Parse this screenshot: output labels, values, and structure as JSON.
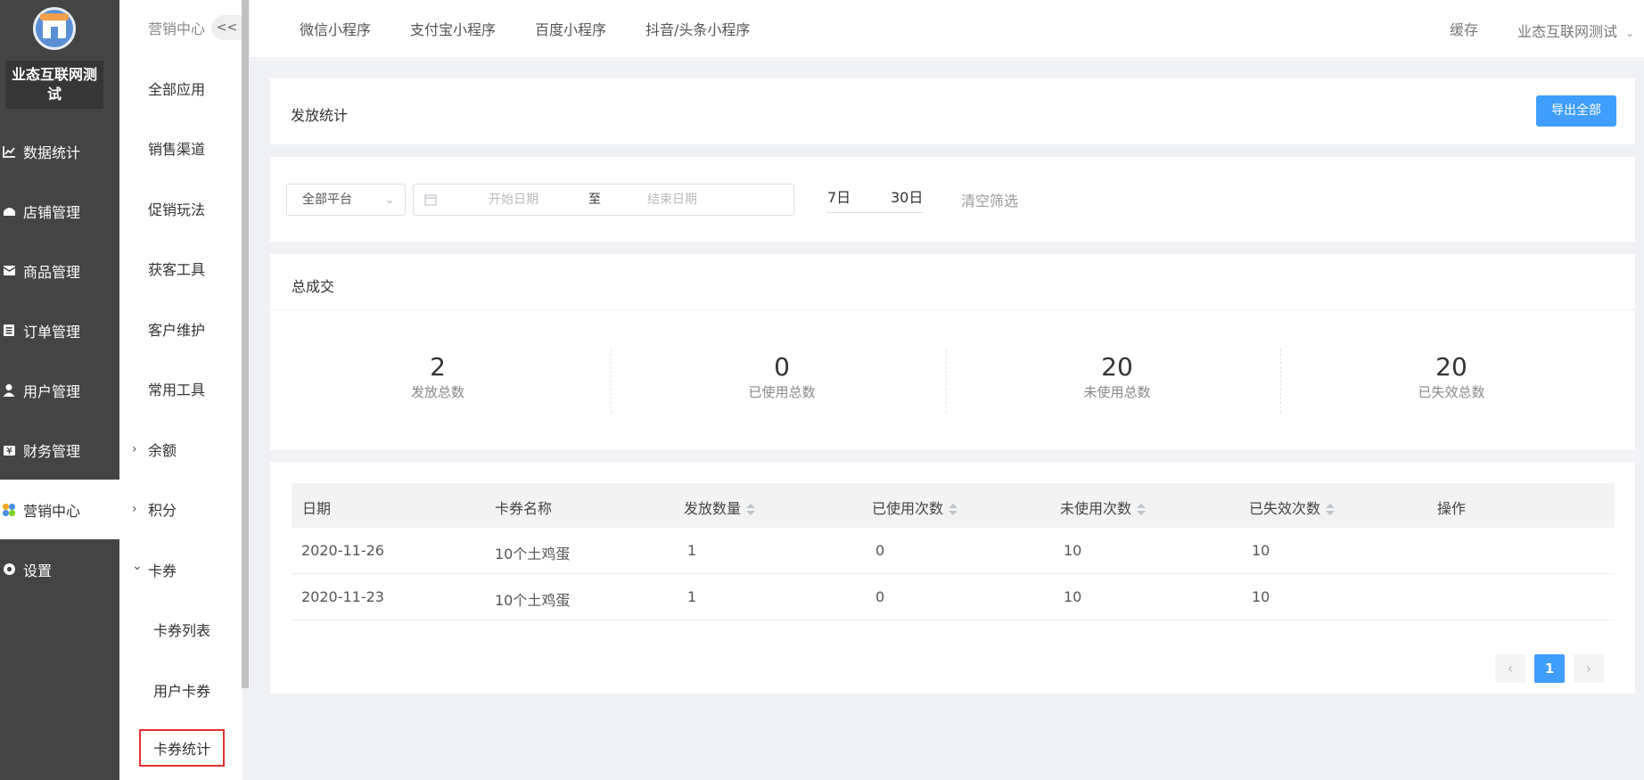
{
  "app": {
    "shop_name": "业态互联网测试"
  },
  "sidebar": {
    "items": [
      {
        "label": "数据统计",
        "icon": "chart-line-icon"
      },
      {
        "label": "店铺管理",
        "icon": "store-icon"
      },
      {
        "label": "商品管理",
        "icon": "product-icon"
      },
      {
        "label": "订单管理",
        "icon": "order-icon"
      },
      {
        "label": "用户管理",
        "icon": "user-icon"
      },
      {
        "label": "财务管理",
        "icon": "finance-icon"
      },
      {
        "label": "营销中心",
        "icon": "marketing-icon",
        "active": true
      },
      {
        "label": "设置",
        "icon": "settings-icon"
      }
    ]
  },
  "subnav": {
    "title": "营销中心",
    "collapse_label": "<<",
    "items": [
      {
        "label": "全部应用"
      },
      {
        "label": "销售渠道"
      },
      {
        "label": "促销玩法"
      },
      {
        "label": "获客工具"
      },
      {
        "label": "客户维护"
      },
      {
        "label": "常用工具"
      },
      {
        "label": "余额",
        "chevron": "›"
      },
      {
        "label": "积分",
        "chevron": "›"
      },
      {
        "label": "卡券",
        "chevron": "⌄"
      },
      {
        "label": "卡券列表"
      },
      {
        "label": "用户卡券"
      },
      {
        "label": "卡券统计",
        "selected": true
      }
    ]
  },
  "topbar": {
    "tabs": [
      "微信小程序",
      "支付宝小程序",
      "百度小程序",
      "抖音/头条小程序"
    ],
    "cache_label": "缓存",
    "account_label": "业态互联网测试"
  },
  "header_card": {
    "title": "发放统计",
    "export_label": "导出全部"
  },
  "filter": {
    "platform_value": "全部平台",
    "start_placeholder": "开始日期",
    "to_label": "至",
    "end_placeholder": "结束日期",
    "quick_7": "7日",
    "quick_30": "30日",
    "clear_label": "清空筛选"
  },
  "summary": {
    "title": "总成交",
    "stats": [
      {
        "value": "2",
        "label": "发放总数"
      },
      {
        "value": "0",
        "label": "已使用总数"
      },
      {
        "value": "20",
        "label": "未使用总数"
      },
      {
        "value": "20",
        "label": "已失效总数"
      }
    ]
  },
  "table": {
    "headers": [
      "日期",
      "卡券名称",
      "发放数量",
      "已使用次数",
      "未使用次数",
      "已失效次数",
      "操作"
    ],
    "rows": [
      [
        "2020-11-26",
        "10个土鸡蛋",
        "1",
        "0",
        "10",
        "10"
      ],
      [
        "2020-11-23",
        "10个土鸡蛋",
        "1",
        "0",
        "10",
        "10"
      ]
    ]
  },
  "pagination": {
    "prev": "‹",
    "current": "1",
    "next": "›"
  }
}
